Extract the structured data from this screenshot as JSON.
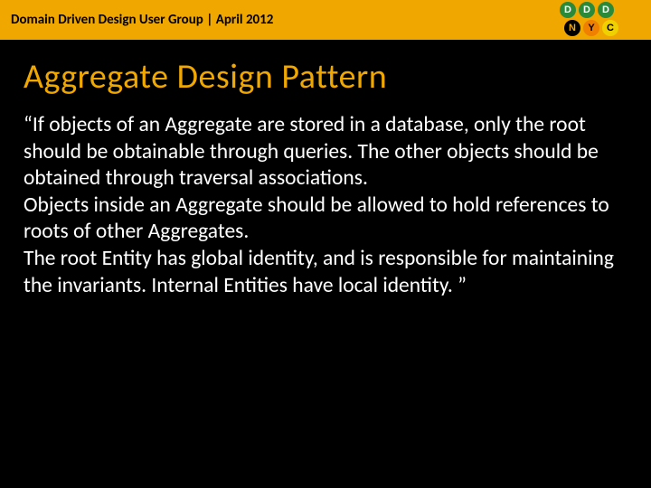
{
  "header": {
    "text": "Domain Driven Design User Group | April 2012"
  },
  "logo": {
    "top": [
      "D",
      "D",
      "D"
    ],
    "bottom": [
      "N",
      "Y",
      "C"
    ]
  },
  "title": "Aggregate Design Pattern",
  "body": "“If objects of an Aggregate are stored in a database, only the root should be obtainable through queries. The other objects should be obtained through traversal associations.\nObjects inside an Aggregate should be allowed to hold references to roots of other Aggregates.\nThe root Entity has global identity, and is responsible for maintaining the invariants. Internal Entities have local identity. ”"
}
